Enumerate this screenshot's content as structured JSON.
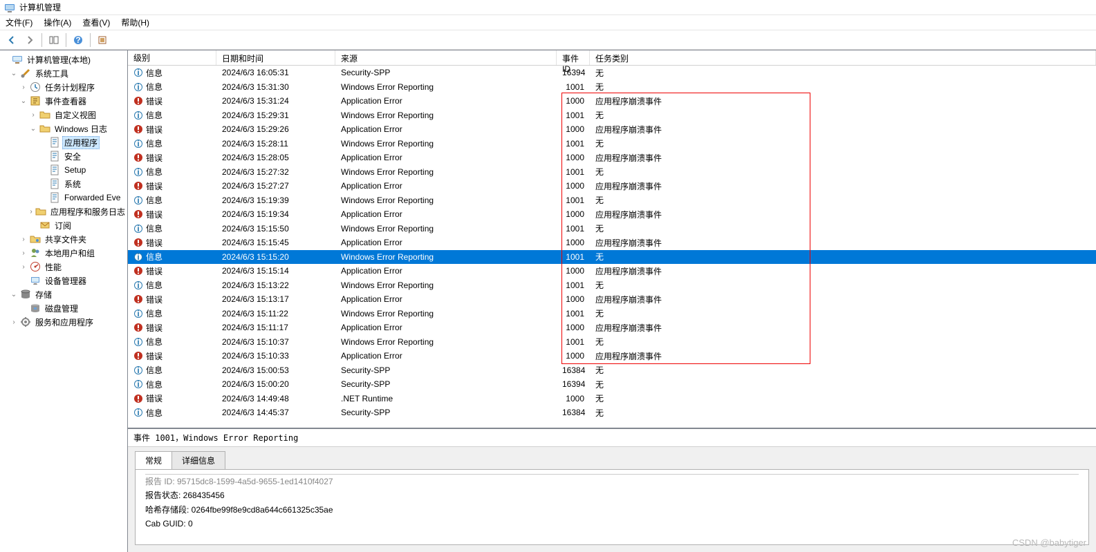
{
  "window": {
    "title": "计算机管理"
  },
  "menu": {
    "file": "文件(F)",
    "action": "操作(A)",
    "view": "查看(V)",
    "help": "帮助(H)"
  },
  "tree": [
    {
      "ind": 0,
      "exp": "",
      "icon": "computer",
      "label": "计算机管理(本地)"
    },
    {
      "ind": 1,
      "exp": "v",
      "icon": "tools",
      "label": "系统工具"
    },
    {
      "ind": 2,
      "exp": ">",
      "icon": "sched",
      "label": "任务计划程序"
    },
    {
      "ind": 2,
      "exp": "v",
      "icon": "event",
      "label": "事件查看器"
    },
    {
      "ind": 3,
      "exp": ">",
      "icon": "folder",
      "label": "自定义视图"
    },
    {
      "ind": 3,
      "exp": "v",
      "icon": "folder",
      "label": "Windows 日志"
    },
    {
      "ind": 4,
      "exp": "",
      "icon": "log",
      "label": "应用程序",
      "sel": true
    },
    {
      "ind": 4,
      "exp": "",
      "icon": "log",
      "label": "安全"
    },
    {
      "ind": 4,
      "exp": "",
      "icon": "log",
      "label": "Setup"
    },
    {
      "ind": 4,
      "exp": "",
      "icon": "log",
      "label": "系统"
    },
    {
      "ind": 4,
      "exp": "",
      "icon": "log",
      "label": "Forwarded Eve"
    },
    {
      "ind": 3,
      "exp": ">",
      "icon": "folder",
      "label": "应用程序和服务日志"
    },
    {
      "ind": 3,
      "exp": "",
      "icon": "sub",
      "label": "订阅"
    },
    {
      "ind": 2,
      "exp": ">",
      "icon": "share",
      "label": "共享文件夹"
    },
    {
      "ind": 2,
      "exp": ">",
      "icon": "users",
      "label": "本地用户和组"
    },
    {
      "ind": 2,
      "exp": ">",
      "icon": "perf",
      "label": "性能"
    },
    {
      "ind": 2,
      "exp": "",
      "icon": "devmgr",
      "label": "设备管理器"
    },
    {
      "ind": 1,
      "exp": "v",
      "icon": "storage",
      "label": "存储"
    },
    {
      "ind": 2,
      "exp": "",
      "icon": "disk",
      "label": "磁盘管理"
    },
    {
      "ind": 1,
      "exp": ">",
      "icon": "services",
      "label": "服务和应用程序"
    }
  ],
  "columns": {
    "level": "级别",
    "datetime": "日期和时间",
    "source": "来源",
    "eventid": "事件 ID",
    "category": "任务类别"
  },
  "rows": [
    {
      "lv": "信息",
      "ic": "info",
      "dt": "2024/6/3 16:05:31",
      "src": "Security-SPP",
      "id": "16394",
      "cat": "无"
    },
    {
      "lv": "信息",
      "ic": "info",
      "dt": "2024/6/3 15:31:30",
      "src": "Windows Error Reporting",
      "id": "1001",
      "cat": "无"
    },
    {
      "lv": "错误",
      "ic": "err",
      "dt": "2024/6/3 15:31:24",
      "src": "Application Error",
      "id": "1000",
      "cat": "应用程序崩溃事件"
    },
    {
      "lv": "信息",
      "ic": "info",
      "dt": "2024/6/3 15:29:31",
      "src": "Windows Error Reporting",
      "id": "1001",
      "cat": "无"
    },
    {
      "lv": "错误",
      "ic": "err",
      "dt": "2024/6/3 15:29:26",
      "src": "Application Error",
      "id": "1000",
      "cat": "应用程序崩溃事件"
    },
    {
      "lv": "信息",
      "ic": "info",
      "dt": "2024/6/3 15:28:11",
      "src": "Windows Error Reporting",
      "id": "1001",
      "cat": "无"
    },
    {
      "lv": "错误",
      "ic": "err",
      "dt": "2024/6/3 15:28:05",
      "src": "Application Error",
      "id": "1000",
      "cat": "应用程序崩溃事件"
    },
    {
      "lv": "信息",
      "ic": "info",
      "dt": "2024/6/3 15:27:32",
      "src": "Windows Error Reporting",
      "id": "1001",
      "cat": "无"
    },
    {
      "lv": "错误",
      "ic": "err",
      "dt": "2024/6/3 15:27:27",
      "src": "Application Error",
      "id": "1000",
      "cat": "应用程序崩溃事件"
    },
    {
      "lv": "信息",
      "ic": "info",
      "dt": "2024/6/3 15:19:39",
      "src": "Windows Error Reporting",
      "id": "1001",
      "cat": "无"
    },
    {
      "lv": "错误",
      "ic": "err",
      "dt": "2024/6/3 15:19:34",
      "src": "Application Error",
      "id": "1000",
      "cat": "应用程序崩溃事件"
    },
    {
      "lv": "信息",
      "ic": "info",
      "dt": "2024/6/3 15:15:50",
      "src": "Windows Error Reporting",
      "id": "1001",
      "cat": "无"
    },
    {
      "lv": "错误",
      "ic": "err",
      "dt": "2024/6/3 15:15:45",
      "src": "Application Error",
      "id": "1000",
      "cat": "应用程序崩溃事件"
    },
    {
      "lv": "信息",
      "ic": "info",
      "dt": "2024/6/3 15:15:20",
      "src": "Windows Error Reporting",
      "id": "1001",
      "cat": "无",
      "sel": true
    },
    {
      "lv": "错误",
      "ic": "err",
      "dt": "2024/6/3 15:15:14",
      "src": "Application Error",
      "id": "1000",
      "cat": "应用程序崩溃事件"
    },
    {
      "lv": "信息",
      "ic": "info",
      "dt": "2024/6/3 15:13:22",
      "src": "Windows Error Reporting",
      "id": "1001",
      "cat": "无"
    },
    {
      "lv": "错误",
      "ic": "err",
      "dt": "2024/6/3 15:13:17",
      "src": "Application Error",
      "id": "1000",
      "cat": "应用程序崩溃事件"
    },
    {
      "lv": "信息",
      "ic": "info",
      "dt": "2024/6/3 15:11:22",
      "src": "Windows Error Reporting",
      "id": "1001",
      "cat": "无"
    },
    {
      "lv": "错误",
      "ic": "err",
      "dt": "2024/6/3 15:11:17",
      "src": "Application Error",
      "id": "1000",
      "cat": "应用程序崩溃事件"
    },
    {
      "lv": "信息",
      "ic": "info",
      "dt": "2024/6/3 15:10:37",
      "src": "Windows Error Reporting",
      "id": "1001",
      "cat": "无"
    },
    {
      "lv": "错误",
      "ic": "err",
      "dt": "2024/6/3 15:10:33",
      "src": "Application Error",
      "id": "1000",
      "cat": "应用程序崩溃事件"
    },
    {
      "lv": "信息",
      "ic": "info",
      "dt": "2024/6/3 15:00:53",
      "src": "Security-SPP",
      "id": "16384",
      "cat": "无"
    },
    {
      "lv": "信息",
      "ic": "info",
      "dt": "2024/6/3 15:00:20",
      "src": "Security-SPP",
      "id": "16394",
      "cat": "无"
    },
    {
      "lv": "错误",
      "ic": "err",
      "dt": "2024/6/3 14:49:48",
      "src": ".NET Runtime",
      "id": "1000",
      "cat": "无"
    },
    {
      "lv": "信息",
      "ic": "info",
      "dt": "2024/6/3 14:45:37",
      "src": "Security-SPP",
      "id": "16384",
      "cat": "无"
    }
  ],
  "detail": {
    "header": "事件 1001，Windows Error Reporting",
    "tab_general": "常规",
    "tab_details": "详细信息",
    "line0": "报告 ID: 95715dc8-1599-4a5d-9655-1ed1410f4027",
    "line1": "报告状态: 268435456",
    "line2": "哈希存储段: 0264fbe99f8e9cd8a644c661325c35ae",
    "line3": "Cab GUID: 0"
  },
  "watermark": "CSDN @babytiger"
}
